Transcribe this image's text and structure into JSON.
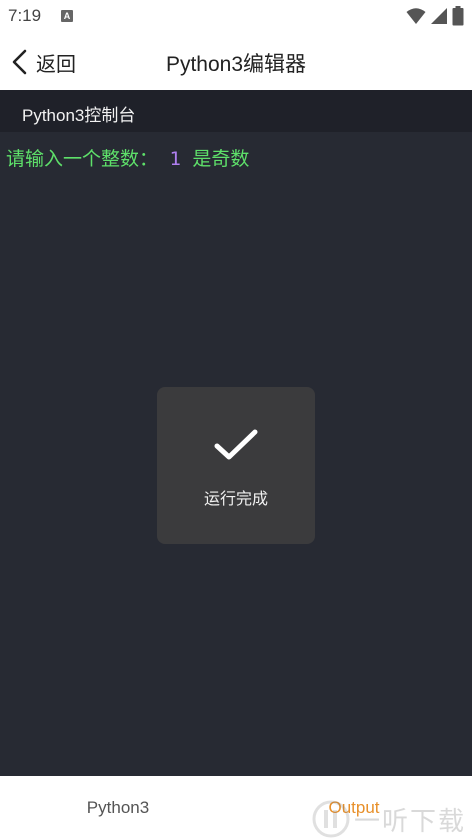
{
  "status_bar": {
    "time": "7:19",
    "notif_icon_letter": "A",
    "icons": [
      "wifi-icon",
      "signal-icon",
      "battery-icon"
    ]
  },
  "header": {
    "back_label": "返回",
    "title": "Python3编辑器"
  },
  "console": {
    "title": "Python3控制台",
    "output": {
      "prompt": "请输入一个整数：",
      "input": "1",
      "result": "是奇数"
    }
  },
  "toast": {
    "icon": "checkmark-icon",
    "message": "运行完成"
  },
  "tabs": [
    {
      "label": "Python3",
      "active": false
    },
    {
      "label": "Output",
      "active": true
    }
  ],
  "watermark": {
    "text": "一听下载"
  },
  "colors": {
    "console_bg": "#272a33",
    "console_header_bg": "#1f2129",
    "output_green": "#5ee06a",
    "input_purple": "#b07ff0",
    "active_tab": "#e8902a"
  }
}
